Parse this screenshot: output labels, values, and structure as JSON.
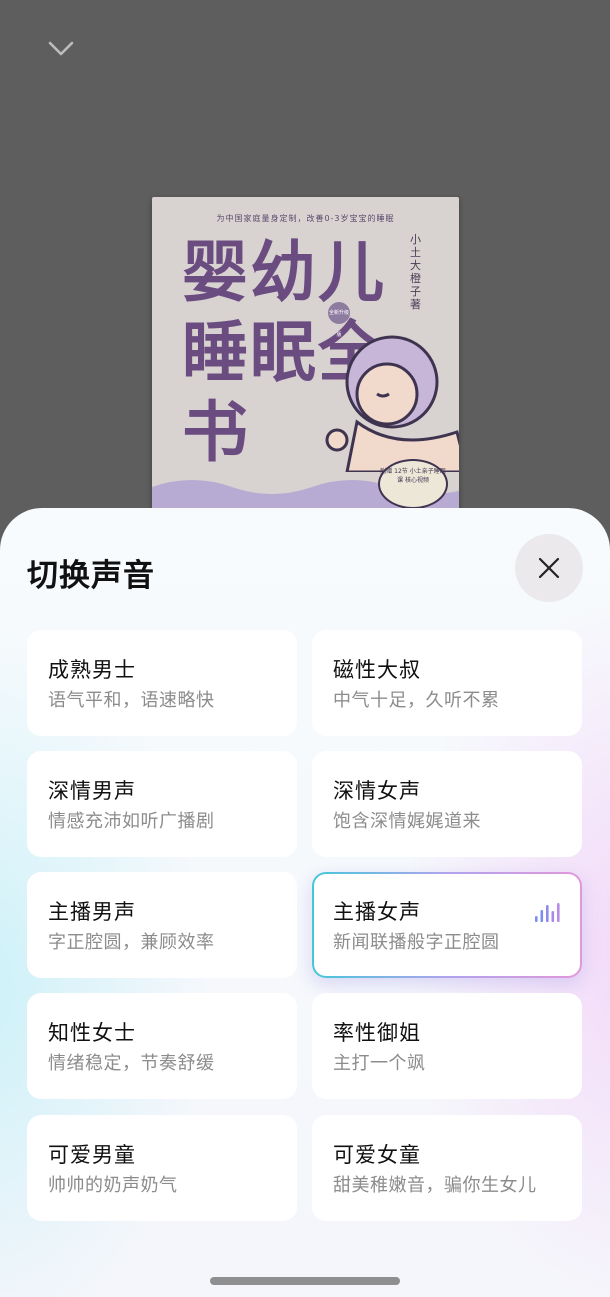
{
  "book": {
    "subtitle": "为中国家庭量身定制，改善0-3岁宝宝的睡眠",
    "title": "婴幼儿睡眠全书",
    "author": "小土大橙子",
    "author_suffix": "著",
    "badge": "全新升级版",
    "addon": "附赠 12节 小土亲子睡眠课 核心视频"
  },
  "sheet": {
    "title": "切换声音",
    "selected_index": 5,
    "voices": [
      {
        "name": "成熟男士",
        "desc": "语气平和，语速略快"
      },
      {
        "name": "磁性大叔",
        "desc": "中气十足，久听不累"
      },
      {
        "name": "深情男声",
        "desc": "情感充沛如听广播剧"
      },
      {
        "name": "深情女声",
        "desc": "饱含深情娓娓道来"
      },
      {
        "name": "主播男声",
        "desc": "字正腔圆，兼顾效率"
      },
      {
        "name": "主播女声",
        "desc": "新闻联播般字正腔圆"
      },
      {
        "name": "知性女士",
        "desc": "情绪稳定，节奏舒缓"
      },
      {
        "name": "率性御姐",
        "desc": "主打一个飒"
      },
      {
        "name": "可爱男童",
        "desc": "帅帅的奶声奶气"
      },
      {
        "name": "可爱女童",
        "desc": "甜美稚嫩音，骗你生女儿"
      }
    ]
  },
  "icons": {
    "collapse": "chevron-down-icon",
    "close": "close-icon",
    "playing": "audio-bars-icon"
  },
  "colors": {
    "overlay": "#5f5e5e",
    "selected_gradient_start": "#45c7d8",
    "selected_gradient_end": "#e397d8",
    "playing_icon": "#7b8ff0"
  }
}
